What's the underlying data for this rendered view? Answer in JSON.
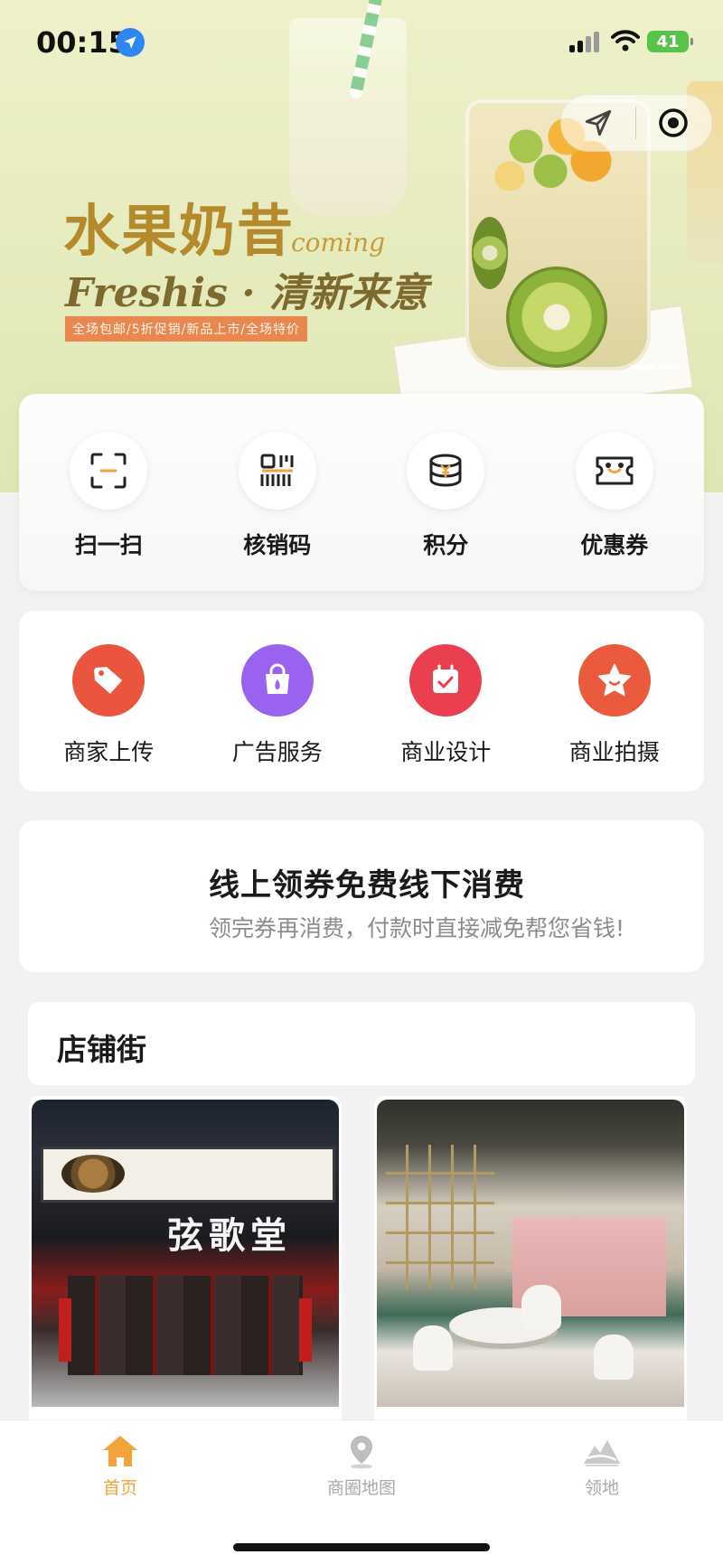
{
  "status_bar": {
    "time": "00:15",
    "battery": "41"
  },
  "banner": {
    "title": "水果奶昔",
    "coming": "coming",
    "subtitle": "Freshis · 清新来意",
    "tags": "全场包邮/5折促销/新品上市/全场特价",
    "slides": 2,
    "active_slide": 0
  },
  "quick_actions": [
    {
      "label": "扫一扫",
      "icon": "scan-icon"
    },
    {
      "label": "核销码",
      "icon": "redeem-code-icon"
    },
    {
      "label": "积分",
      "icon": "points-icon"
    },
    {
      "label": "优惠券",
      "icon": "coupon-icon"
    }
  ],
  "services": [
    {
      "label": "商家上传",
      "icon": "tag-icon",
      "color": "#e9553e"
    },
    {
      "label": "广告服务",
      "icon": "bag-icon",
      "color": "#9a63ef"
    },
    {
      "label": "商业设计",
      "icon": "calendar-check-icon",
      "color": "#ea3f4f"
    },
    {
      "label": "商业拍摄",
      "icon": "star-icon",
      "color": "#ea5a3c"
    }
  ],
  "promo": {
    "title": "线上领券免费线下消费",
    "subtitle": "领完券再消费，付款时直接减免帮您省钱!"
  },
  "street": {
    "title": "店铺街",
    "store_sign": "弦歌堂"
  },
  "tabs": [
    {
      "label": "首页",
      "icon": "home-icon",
      "active": true
    },
    {
      "label": "商圈地图",
      "icon": "map-pin-icon",
      "active": false
    },
    {
      "label": "领地",
      "icon": "territory-icon",
      "active": false
    }
  ],
  "colors": {
    "accent": "#f2a33a",
    "inactive": "#a9a9a9"
  }
}
